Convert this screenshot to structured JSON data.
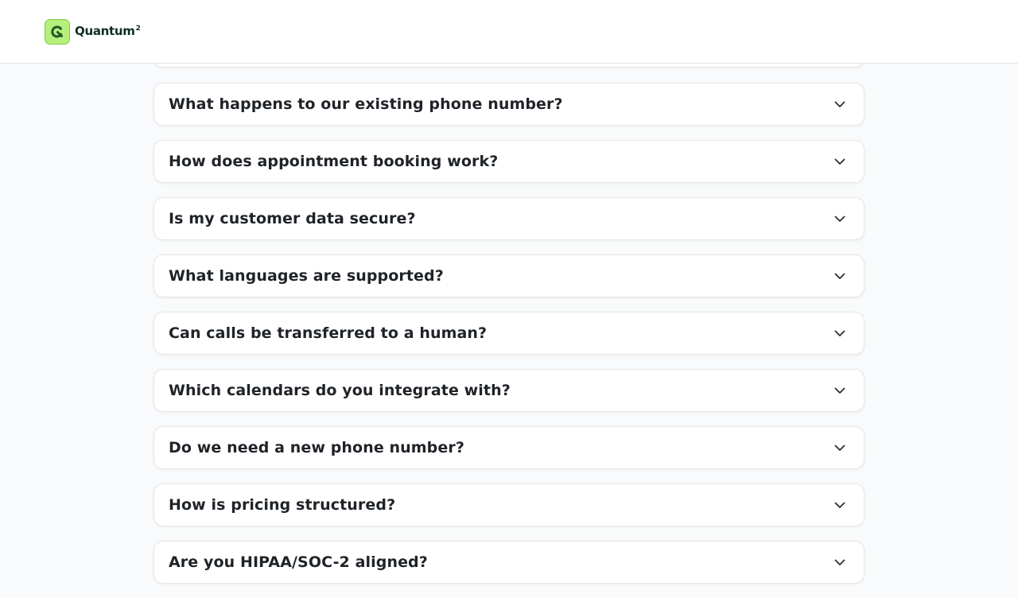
{
  "header": {
    "brand_name": "Quantum",
    "brand_sup": "2"
  },
  "faq": {
    "items": [
      {
        "question": "What happens to our existing phone number?"
      },
      {
        "question": "How does appointment booking work?"
      },
      {
        "question": "Is my customer data secure?"
      },
      {
        "question": "What languages are supported?"
      },
      {
        "question": "Can calls be transferred to a human?"
      },
      {
        "question": "Which calendars do you integrate with?"
      },
      {
        "question": "Do we need a new phone number?"
      },
      {
        "question": "How is pricing structured?"
      },
      {
        "question": "Are you HIPAA/SOC-2 aligned?"
      }
    ]
  },
  "colors": {
    "brand_accent": "#b6f07a",
    "brand_dark": "#0f2d22",
    "text": "#1f2328",
    "border": "#e5e7eb"
  },
  "icons": {
    "logo": "q-logo-icon",
    "expand": "chevron-down-icon"
  }
}
